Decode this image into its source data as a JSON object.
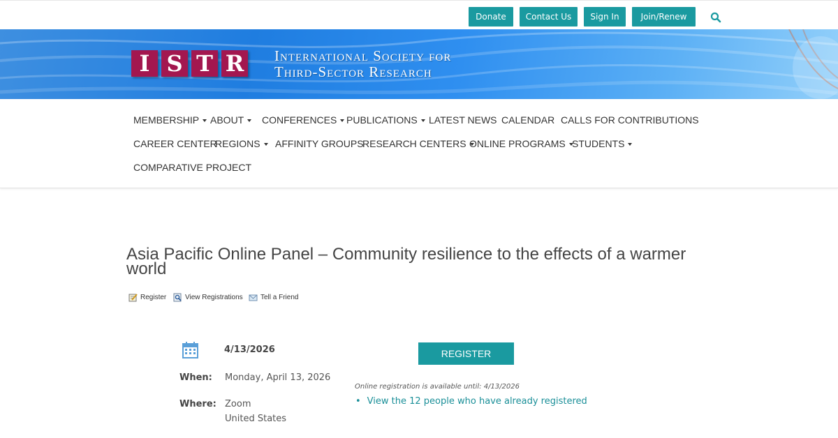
{
  "topbar": {
    "donate": "Donate",
    "contact": "Contact Us",
    "signin": "Sign In",
    "join": "Join/Renew"
  },
  "logo": {
    "letters": [
      "I",
      "S",
      "T",
      "R"
    ],
    "line1": "International Society for",
    "line2": "Third-Sector Research"
  },
  "nav": {
    "row1": [
      "MEMBERSHIP",
      "ABOUT",
      "CONFERENCES",
      "PUBLICATIONS",
      "LATEST NEWS",
      "CALENDAR",
      "CALLS FOR CONTRIBUTIONS"
    ],
    "row2": [
      "CAREER CENTER",
      "REGIONS",
      "AFFINITY GROUPS",
      "RESEARCH CENTERS",
      "ONLINE PROGRAMS",
      "STUDENTS"
    ],
    "row3": [
      "COMPARATIVE PROJECT"
    ]
  },
  "event": {
    "title": "Asia Pacific Online Panel – Community resilience to the effects of a warmer world",
    "actions": {
      "register": "Register",
      "view_registrations": "View Registrations",
      "tell_friend": "Tell a Friend"
    },
    "date_short": "4/13/2026",
    "when_label": "When:",
    "when_value": "Monday, April 13, 2026",
    "where_label": "Where:",
    "where_line1": "Zoom",
    "where_line2": "United States",
    "register_button": "REGISTER",
    "registration_note": "Online registration is available until: 4/13/2026",
    "registered_link": "View the 12 people who have already registered"
  },
  "colors": {
    "accent": "#1a9aa0",
    "logo_box": "#a3174f",
    "link": "#1a8f98"
  }
}
